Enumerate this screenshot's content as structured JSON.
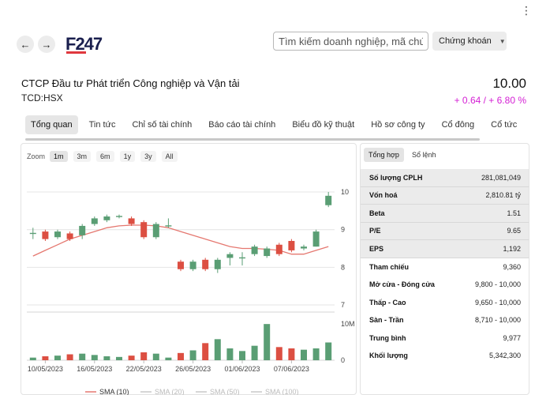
{
  "header": {
    "search_placeholder": "Tìm kiếm doanh nghiệp, mã chứng khoán",
    "market_label": "Chứng khoán",
    "more_icon": "more-vertical-icon"
  },
  "logo": {
    "text": "F247"
  },
  "company": {
    "name": "CTCP Đầu tư Phát triển Công nghiệp và Vận tải",
    "ticker": "TCD:HSX",
    "price": "10.00",
    "change": "+ 0.64 / + 6.80 %"
  },
  "tabs": [
    {
      "label": "Tổng quan",
      "active": true
    },
    {
      "label": "Tin tức"
    },
    {
      "label": "Chỉ số tài chính"
    },
    {
      "label": "Báo cáo tài chính"
    },
    {
      "label": "Biểu đồ kỹ thuật"
    },
    {
      "label": "Hồ sơ công ty"
    },
    {
      "label": "Cổ đông"
    },
    {
      "label": "Cổ tức"
    }
  ],
  "zoom": {
    "label": "Zoom",
    "options": [
      "1m",
      "3m",
      "6m",
      "1y",
      "3y",
      "All"
    ],
    "selected": "1m"
  },
  "stats": {
    "tabs": [
      "Tổng hợp",
      "Sổ lệnh"
    ],
    "rows": [
      {
        "label": "Số lượng CPLH",
        "value": "281,081,049"
      },
      {
        "label": "Vốn hoá",
        "value": "2,810.81 tỷ"
      },
      {
        "label": "Beta",
        "value": "1.51"
      },
      {
        "label": "P/E",
        "value": "9.65"
      },
      {
        "label": "EPS",
        "value": "1,192"
      },
      {
        "label": "Tham chiếu",
        "value": "9,360"
      },
      {
        "label": "Mở cửa - Đóng cửa",
        "value": "9,800 - 10,000"
      },
      {
        "label": "Thấp - Cao",
        "value": "9,650 - 10,000"
      },
      {
        "label": "Sàn - Trần",
        "value": "8,710 - 10,000"
      },
      {
        "label": "Trung bình",
        "value": "9,977"
      },
      {
        "label": "Khối lượng",
        "value": "5,342,300"
      }
    ]
  },
  "chart_data": {
    "type": "candlestick",
    "price_axis": {
      "ticks": [
        7,
        8,
        9,
        10
      ],
      "range": [
        7,
        10.4
      ]
    },
    "volume_axis": {
      "ticks": [
        "0",
        "10M"
      ]
    },
    "x_ticks": [
      "10/05/2023",
      "16/05/2023",
      "22/05/2023",
      "26/05/2023",
      "01/06/2023",
      "07/06/2023"
    ],
    "candles": [
      {
        "o": 8.9,
        "c": 8.9,
        "h": 9.05,
        "l": 8.75,
        "vol": 0.4
      },
      {
        "o": 8.95,
        "c": 8.75,
        "h": 9.0,
        "l": 8.7,
        "vol": 0.6
      },
      {
        "o": 8.8,
        "c": 8.95,
        "h": 9.0,
        "l": 8.75,
        "vol": 0.7
      },
      {
        "o": 8.9,
        "c": 8.75,
        "h": 8.95,
        "l": 8.7,
        "vol": 0.9
      },
      {
        "o": 8.85,
        "c": 9.1,
        "h": 9.15,
        "l": 8.75,
        "vol": 1.0
      },
      {
        "o": 9.15,
        "c": 9.3,
        "h": 9.35,
        "l": 9.1,
        "vol": 0.8
      },
      {
        "o": 9.25,
        "c": 9.35,
        "h": 9.4,
        "l": 9.2,
        "vol": 0.6
      },
      {
        "o": 9.35,
        "c": 9.35,
        "h": 9.4,
        "l": 9.3,
        "vol": 0.5
      },
      {
        "o": 9.3,
        "c": 9.15,
        "h": 9.35,
        "l": 9.1,
        "vol": 0.7
      },
      {
        "o": 9.2,
        "c": 8.8,
        "h": 9.25,
        "l": 8.75,
        "vol": 1.2
      },
      {
        "o": 8.8,
        "c": 9.15,
        "h": 9.2,
        "l": 8.75,
        "vol": 1.0
      },
      {
        "o": 9.1,
        "c": 9.1,
        "h": 9.3,
        "l": 9.05,
        "vol": 0.4
      },
      {
        "o": 8.15,
        "c": 7.95,
        "h": 8.2,
        "l": 7.9,
        "vol": 1.1
      },
      {
        "o": 7.95,
        "c": 8.15,
        "h": 8.2,
        "l": 7.9,
        "vol": 1.5
      },
      {
        "o": 8.2,
        "c": 7.95,
        "h": 8.25,
        "l": 7.9,
        "vol": 2.6
      },
      {
        "o": 7.95,
        "c": 8.2,
        "h": 8.25,
        "l": 7.85,
        "vol": 3.2
      },
      {
        "o": 8.25,
        "c": 8.35,
        "h": 8.4,
        "l": 8.05,
        "vol": 1.8
      },
      {
        "o": 8.25,
        "c": 8.25,
        "h": 8.4,
        "l": 8.05,
        "vol": 1.4
      },
      {
        "o": 8.35,
        "c": 8.55,
        "h": 8.6,
        "l": 8.3,
        "vol": 2.2
      },
      {
        "o": 8.3,
        "c": 8.5,
        "h": 8.55,
        "l": 8.25,
        "vol": 5.5
      },
      {
        "o": 8.6,
        "c": 8.35,
        "h": 8.65,
        "l": 8.3,
        "vol": 2.0
      },
      {
        "o": 8.7,
        "c": 8.45,
        "h": 8.75,
        "l": 8.4,
        "vol": 1.8
      },
      {
        "o": 8.5,
        "c": 8.55,
        "h": 8.6,
        "l": 8.45,
        "vol": 1.6
      },
      {
        "o": 8.55,
        "c": 8.95,
        "h": 9.0,
        "l": 8.55,
        "vol": 1.8
      },
      {
        "o": 9.65,
        "c": 9.9,
        "h": 10.0,
        "l": 9.6,
        "vol": 2.7
      }
    ],
    "sma10": [
      8.3,
      8.45,
      8.6,
      8.75,
      8.85,
      8.95,
      9.05,
      9.1,
      9.12,
      9.12,
      9.1,
      9.05,
      8.95,
      8.85,
      8.75,
      8.65,
      8.55,
      8.5,
      8.5,
      8.48,
      8.45,
      8.35,
      8.35,
      8.45,
      8.55
    ],
    "legend": [
      "SMA (10)",
      "SMA (20)",
      "SMA (50)",
      "SMA (100)"
    ],
    "colors": {
      "up": "#5a9e74",
      "down": "#dc4f42",
      "sma": "#e57870",
      "grid": "#e4e4e4"
    }
  }
}
